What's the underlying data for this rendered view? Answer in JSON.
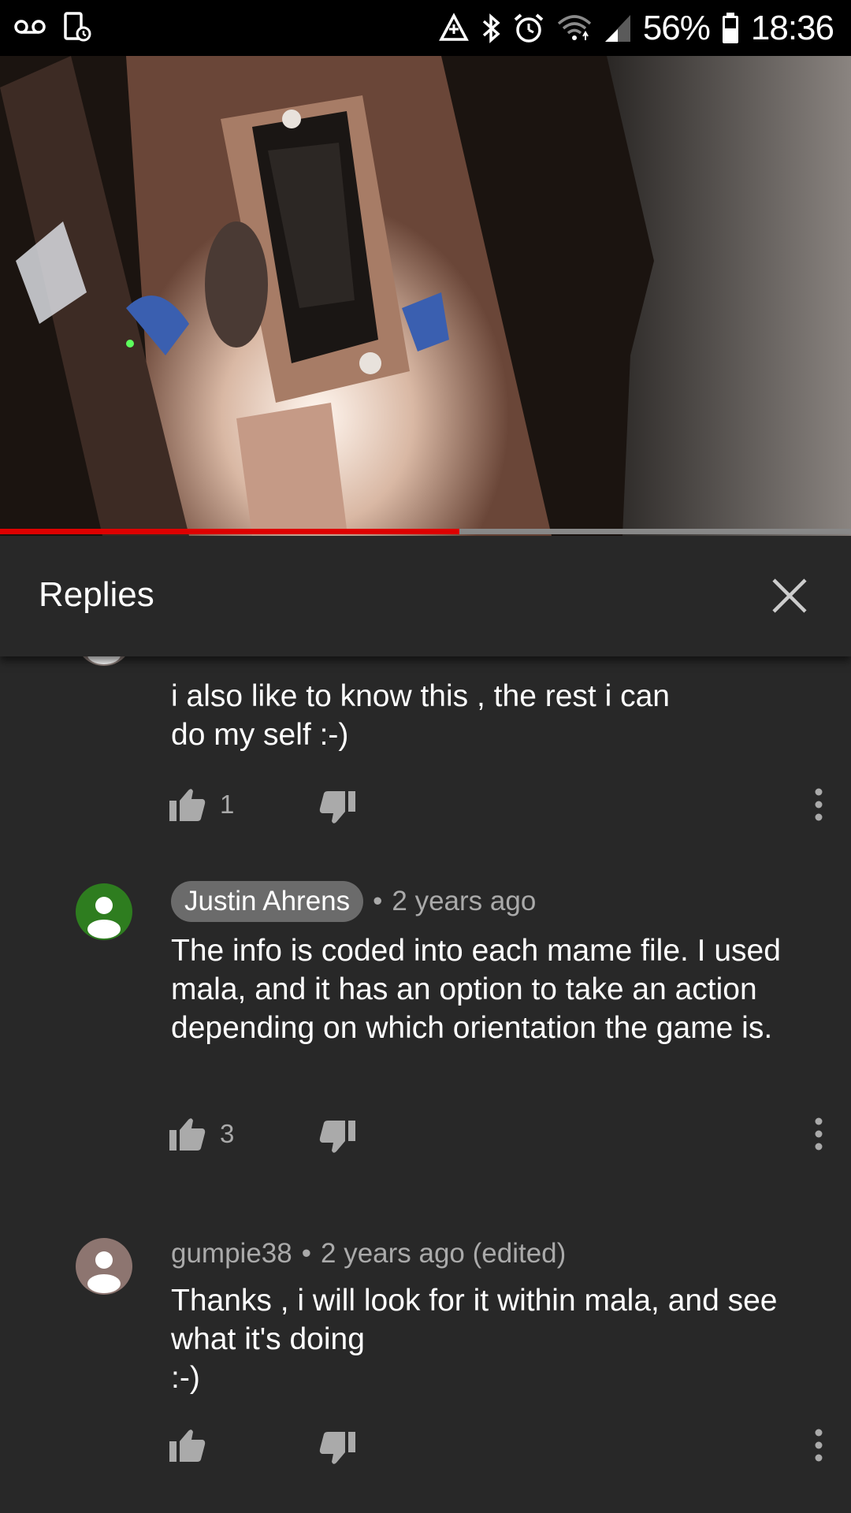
{
  "status_bar": {
    "left_icons": [
      "voicemail-icon",
      "screen-record-icon"
    ],
    "right_icons": [
      "data-saver-icon",
      "bluetooth-icon",
      "alarm-icon",
      "wifi-icon",
      "signal-icon"
    ],
    "battery": "56%",
    "time": "18:36"
  },
  "video": {
    "progress": 0.54,
    "progress_color": "#e00000"
  },
  "replies_panel": {
    "title": "Replies",
    "close_icon": "close-icon"
  },
  "comments": [
    {
      "author": "",
      "time": "",
      "text": "i also like to know this , the rest i can\ndo my self :-)",
      "likes": "1",
      "avatar_color": "#8d7f7a"
    },
    {
      "author": "Justin Ahrens",
      "time": "2 years ago",
      "text": "The info is coded into each mame file. I used mala, and it has an option to take an action depending on which orientation the game is.",
      "likes": "3",
      "avatar_color": "#2e7d1f",
      "highlighted_author": true
    },
    {
      "author": "gumpie38",
      "time": "2 years ago (edited)",
      "text": "Thanks , i will look for it within mala, and see what it's doing\n:-)",
      "likes": "",
      "avatar_color": "#8d7570"
    }
  ],
  "colors": {
    "background": "#282828",
    "secondary_text": "#aaaaaa",
    "chip": "#6b6b6b"
  }
}
